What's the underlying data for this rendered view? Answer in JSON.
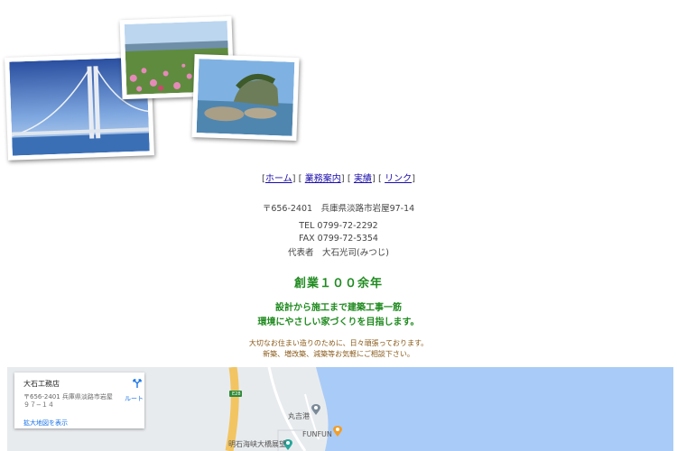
{
  "nav": {
    "items": [
      "ホーム",
      "業務案内",
      "実績",
      "リンク"
    ]
  },
  "company": {
    "address": "〒656-2401　兵庫県淡路市岩屋97-14",
    "tel": "TEL 0799-72-2292",
    "fax": "FAX 0799-72-5354",
    "rep": "代表者　大石光司(みつじ)"
  },
  "headline": "創業１００余年",
  "tagline": [
    "設計から施工まで建築工事一筋",
    "環境にやさしい家づくりを目指します。"
  ],
  "note": [
    "大切なお住まい造りのために、日々頑張っております。",
    "新築、増改築、減築等お気軽にご相談下さい。"
  ],
  "map": {
    "place_name": "大石工務店",
    "place_address": "〒656-2401 兵庫県淡路市岩屋９７−１４",
    "route_label": "ルート",
    "larger_map_link": "拡大地図を表示",
    "road_sign": "E28",
    "labels": [
      "丸吉港",
      "FUNFUN",
      "明石海峡大橋展望"
    ]
  },
  "colors": {
    "accent_green": "#1f8a1f",
    "note_brown": "#8a5a1a",
    "link": "#1a0dab",
    "sea": "#a9cbf7"
  }
}
